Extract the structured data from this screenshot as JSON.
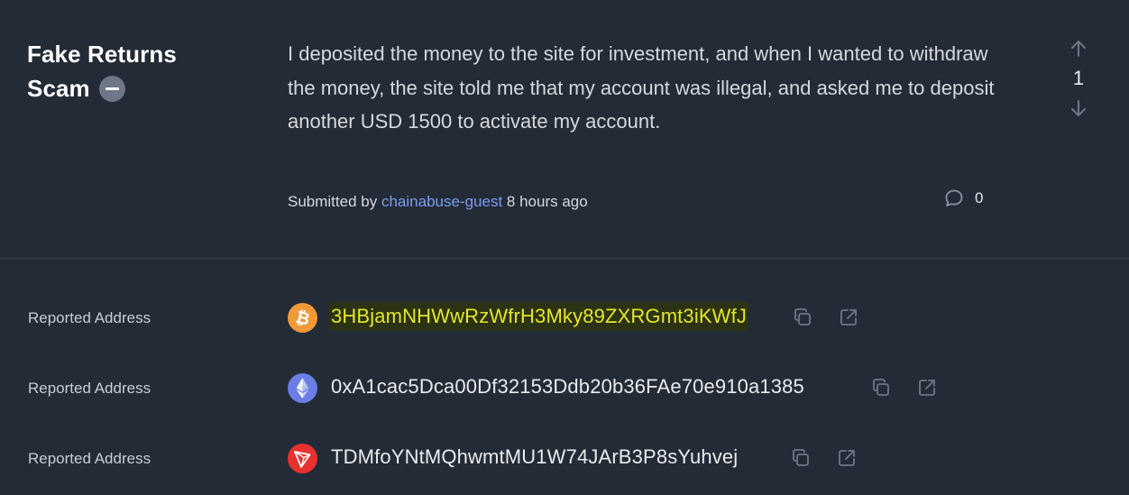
{
  "report": {
    "title_line1": "Fake Returns",
    "title_line2": "Scam",
    "description": "I deposited the money to the site for investment, and when I wanted to withdraw the money, the site told me that my account was illegal, and asked me to deposit another USD 1500 to activate my account.",
    "vote_count": "1",
    "submitted_prefix": "Submitted by",
    "submitted_user": "chainabuse-guest",
    "submitted_time": "8 hours ago",
    "comment_count": "0"
  },
  "addresses": [
    {
      "label": "Reported Address",
      "chain_icon": "bitcoin-icon",
      "address": "3HBjamNHWwRzWfrH3Mky89ZXRGmt3iKWfJ",
      "highlighted": true,
      "color": "#f09a37"
    },
    {
      "label": "Reported Address",
      "chain_icon": "ethereum-icon",
      "address": "0xA1cac5Dca00Df32153Ddb20b36FAe70e910a1385",
      "highlighted": false,
      "color": "#6a7ee6"
    },
    {
      "label": "Reported Address",
      "chain_icon": "tron-icon",
      "address": "TDMfoYNtMQhwmtMU1W74JArB3P8sYuhvej",
      "highlighted": false,
      "color": "#e8312f"
    }
  ],
  "colors": {
    "background": "#232b36",
    "link": "#7d9cf2",
    "highlight_text": "#e4e629",
    "highlight_bg": "#2c3314"
  }
}
